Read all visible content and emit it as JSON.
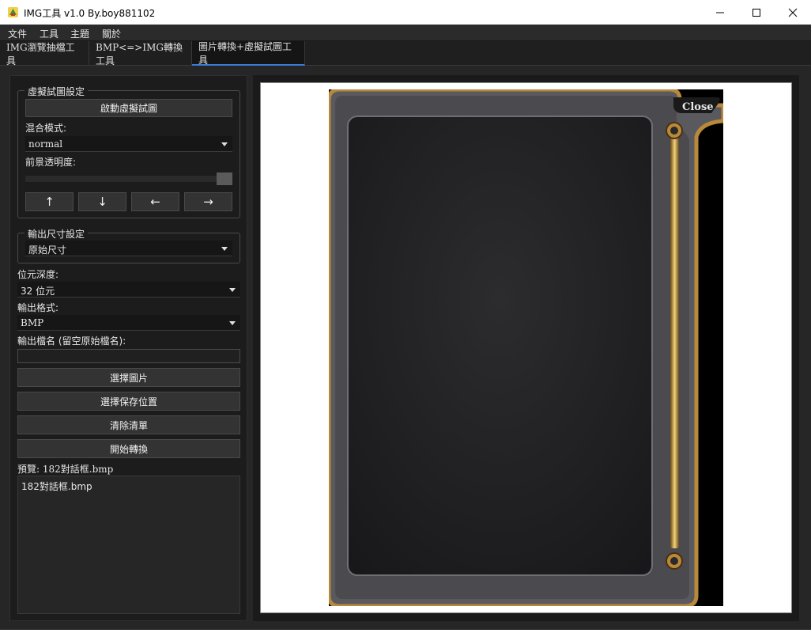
{
  "window": {
    "title": "IMG工具 v1.0 By.boy881102",
    "icon": "app-icon"
  },
  "menu": [
    "文件",
    "工具",
    "主題",
    "關於"
  ],
  "tabs": [
    {
      "label": "IMG瀏覽抽檔工具",
      "active": false
    },
    {
      "label": "BMP<=>IMG轉換工具",
      "active": false
    },
    {
      "label": "圖片轉換+虛擬試圖工具",
      "active": true
    }
  ],
  "virtual_view": {
    "group_title": "虛擬試圖設定",
    "start_button": "啟動虛擬試圖",
    "blend_label": "混合模式:",
    "blend_value": "normal",
    "opacity_label": "前景透明度:",
    "opacity_value": 1.0,
    "arrows": [
      "↑",
      "↓",
      "←",
      "→"
    ]
  },
  "output_size": {
    "group_title": "輸出尺寸設定",
    "value": "原始尺寸"
  },
  "bit_depth": {
    "label": "位元深度:",
    "value": "32 位元"
  },
  "output_format": {
    "label": "輸出格式:",
    "value": "BMP"
  },
  "output_name": {
    "label": "輸出檔名 (留空原始檔名):",
    "value": ""
  },
  "buttons": {
    "select_image": "選擇圖片",
    "select_save": "選擇保存位置",
    "clear_list": "清除清單",
    "start_convert": "開始轉換"
  },
  "preview": {
    "label": "預覽: 182對話框.bmp",
    "files": [
      "182對話框.bmp"
    ],
    "image_close_text": "Close"
  },
  "colors": {
    "frame_gold": "#b8893a",
    "panel_dark": "#1c1c1c",
    "accent": "#3a7bd5"
  }
}
